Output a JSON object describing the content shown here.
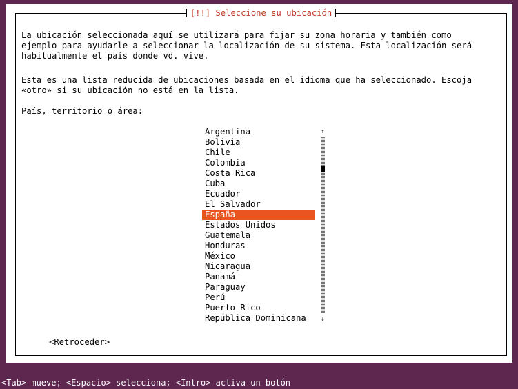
{
  "dialog": {
    "title": "[!!] Seleccione su ubicación",
    "paragraph1": [
      "La ubicación seleccionada aquí se utilizará para fijar su zona horaria y también como",
      "ejemplo para ayudarle a seleccionar la localización de su sistema. Esta localización será",
      "habitualmente el país donde vd. vive."
    ],
    "paragraph2": [
      "Esta es una lista reducida de ubicaciones basada en el idioma que ha seleccionado. Escoja",
      "«otro» si su ubicación no está en la lista."
    ],
    "prompt": "País, territorio o área:",
    "countries": [
      "Argentina",
      "Bolivia",
      "Chile",
      "Colombia",
      "Costa Rica",
      "Cuba",
      "Ecuador",
      "El Salvador",
      "España",
      "Estados Unidos",
      "Guatemala",
      "Honduras",
      "México",
      "Nicaragua",
      "Panamá",
      "Paraguay",
      "Perú",
      "Puerto Rico",
      "República Dominicana"
    ],
    "selected_country": "España",
    "scroll_up_arrow": "↑",
    "scroll_down_arrow": "↓",
    "back_button": "<Retroceder>"
  },
  "statusbar": {
    "text": "<Tab> mueve; <Espacio> selecciona; <Intro> activa un botón"
  },
  "colors": {
    "background": "#5e2750",
    "selection": "#e95420",
    "title": "#c03a2b"
  }
}
